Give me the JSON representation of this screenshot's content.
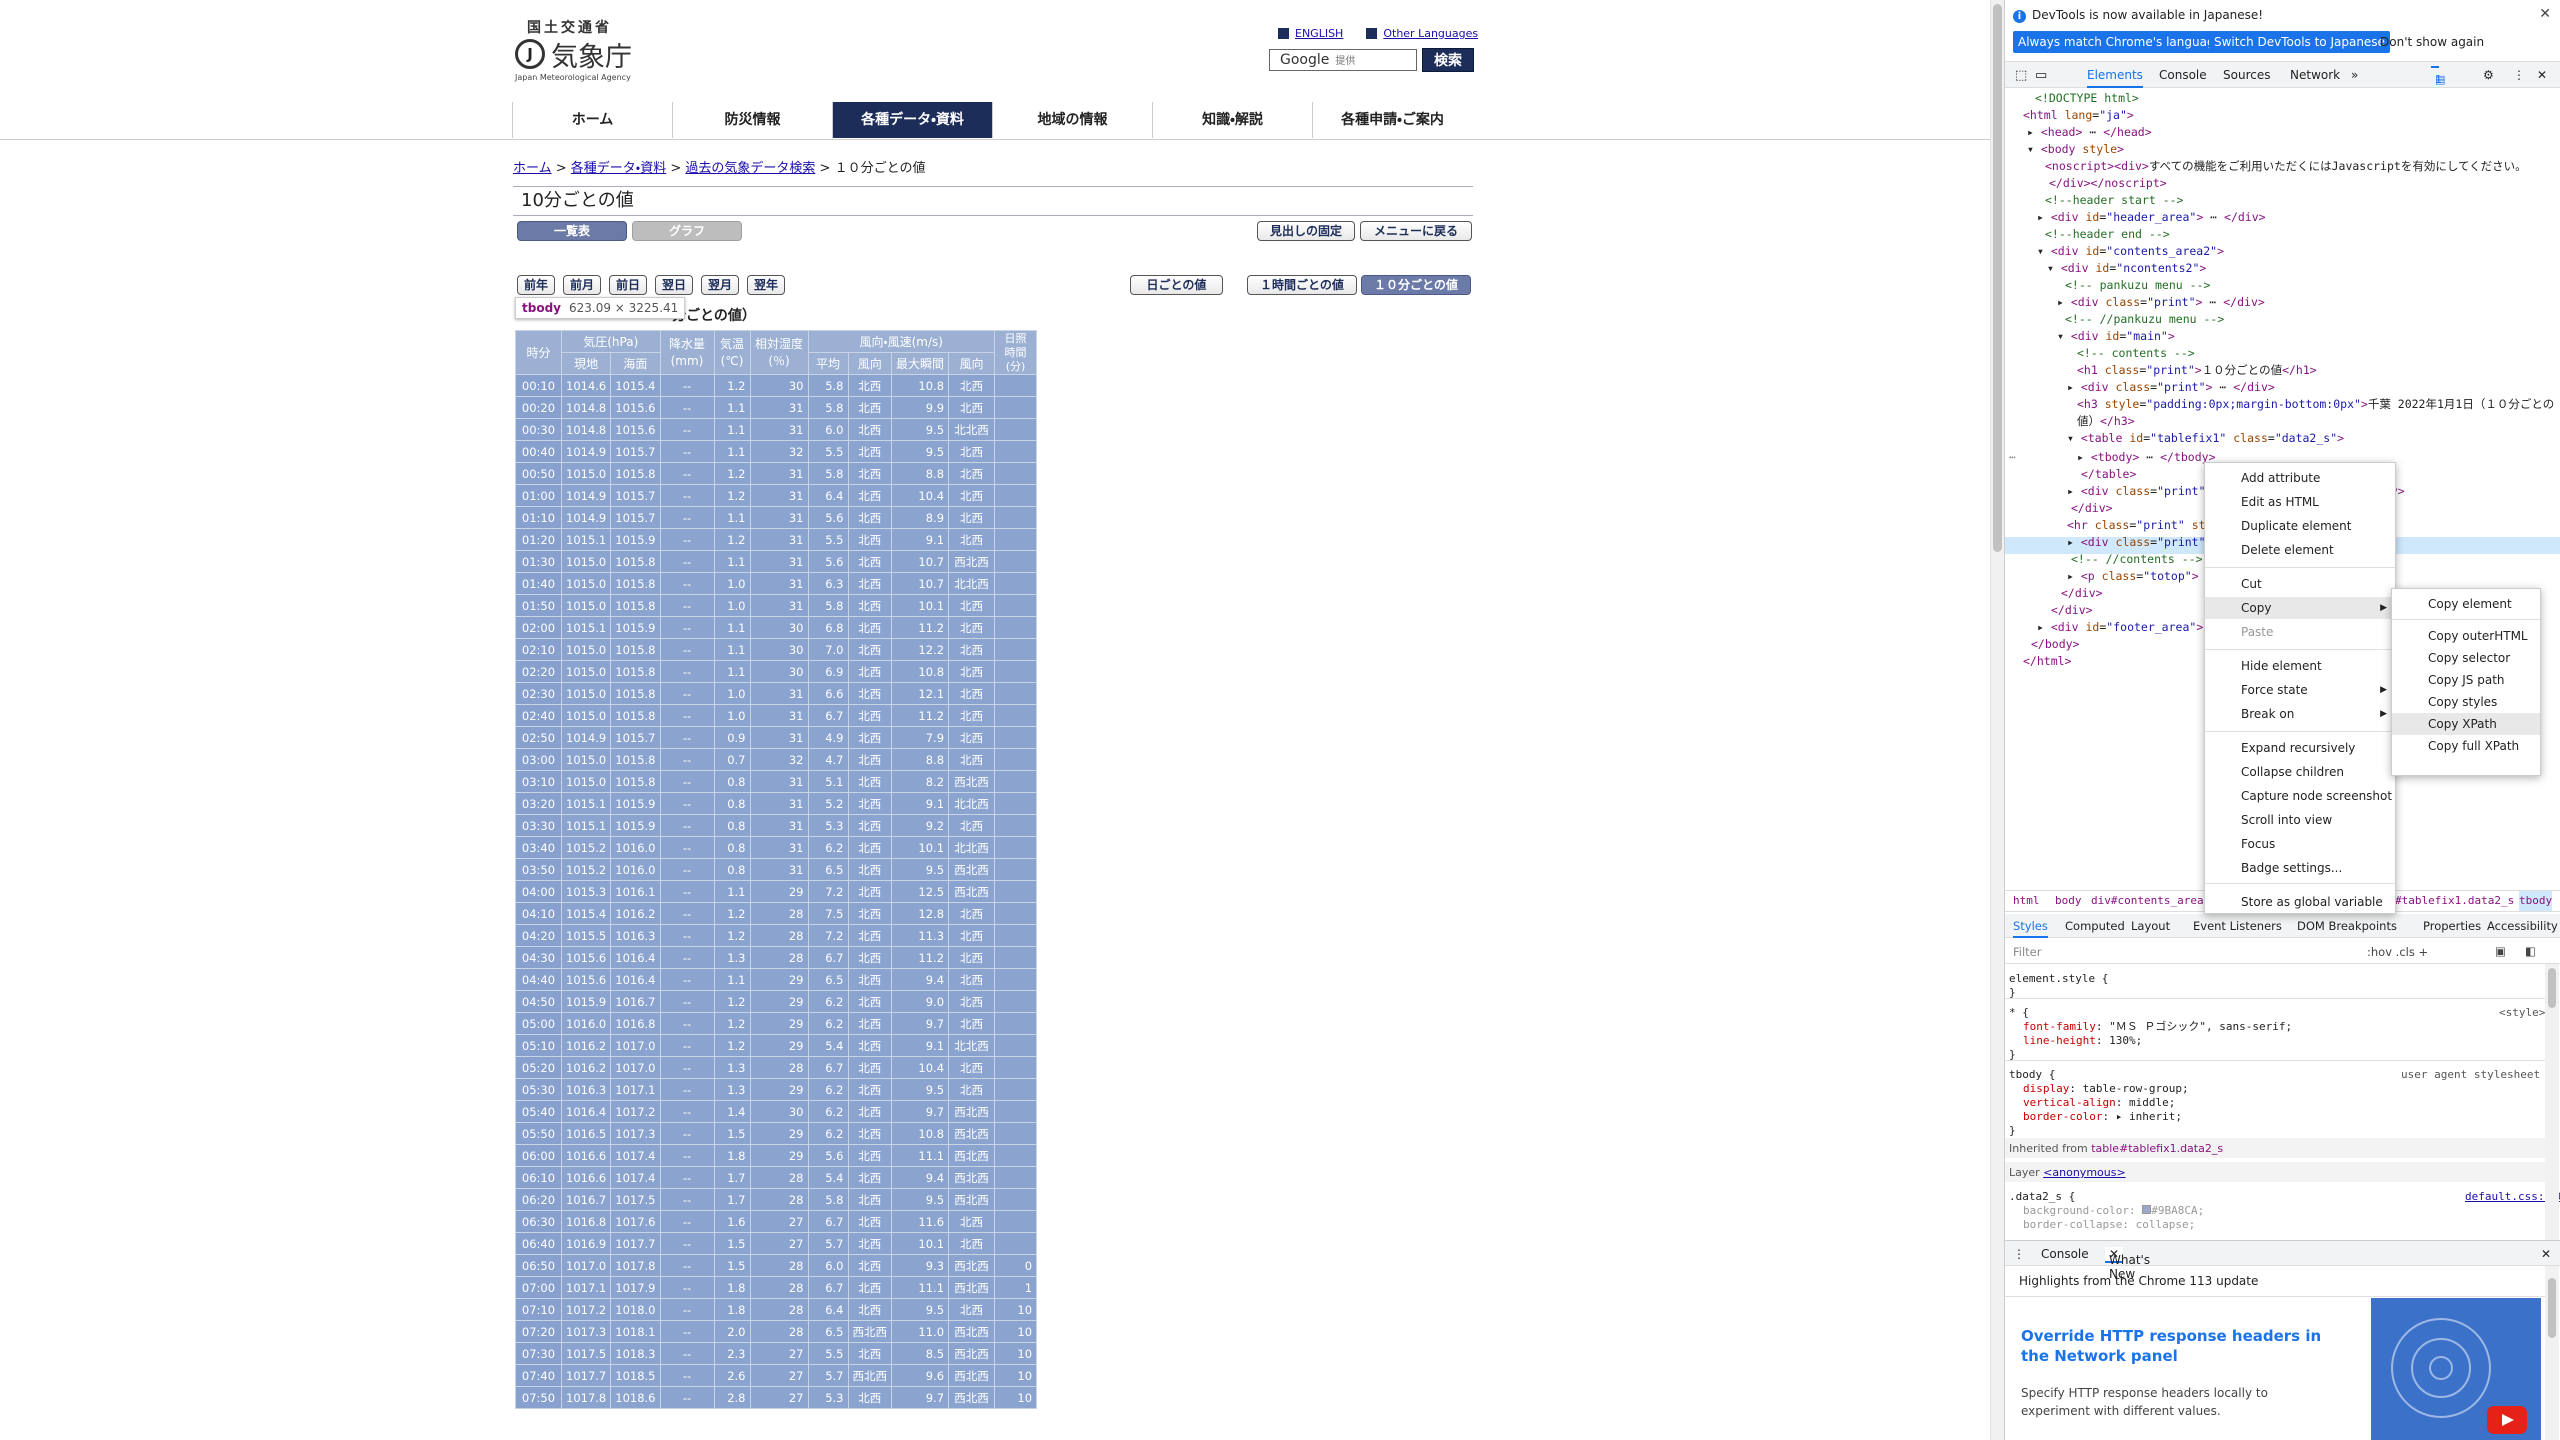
{
  "site": {
    "ministry": "国土交通省",
    "agency": "気象庁",
    "agency_en": "Japan Meteorological Agency",
    "english_link": "ENGLISH",
    "other_lang_link": "Other Languages",
    "search_placeholder_logo": "Google",
    "search_placeholder_text": "提供",
    "search_button": "検索",
    "nav": [
      "ホーム",
      "防災情報",
      "各種データ・資料",
      "地域の情報",
      "知識・解説",
      "各種申請・ご案内"
    ]
  },
  "breadcrumb": {
    "home": "ホーム",
    "data": "各種データ・資料",
    "past": "過去の気象データ検索",
    "current": "１０分ごとの値"
  },
  "page": {
    "title": "10分ごとの値",
    "tab_list": "一覧表",
    "tab_graph": "グラフ",
    "fix_header": "見出しの固定",
    "back_menu": "メニューに戻る",
    "nav_buttons": [
      "前年",
      "前月",
      "前日",
      "翌日",
      "翌月",
      "翌年"
    ],
    "btn_daily": "日ごとの値",
    "btn_hourly": "１時間ごとの値",
    "btn_10min": "１０分ごとの値",
    "subheading": "分ごとの値）",
    "tooltip_tag": "tbody",
    "tooltip_size": "623.09 × 3225.41"
  },
  "table": {
    "h_time": "時分",
    "h_pressure": "気圧(hPa)",
    "h_precip": "降水量 (mm)",
    "h_temp": "気温 (℃)",
    "h_humidity": "相対湿度 (％)",
    "h_wind": "風向・風速(m/s)",
    "h_sun": "日照 時間 (分)",
    "h_local": "現地",
    "h_sea": "海面",
    "h_avg": "平均",
    "h_dir": "風向",
    "h_gust": "最大瞬間",
    "h_gustdir": "風向",
    "rows": [
      [
        "00:10",
        "1014.6",
        "1015.4",
        "--",
        "1.2",
        "30",
        "5.8",
        "北西",
        "10.8",
        "北西",
        ""
      ],
      [
        "00:20",
        "1014.8",
        "1015.6",
        "--",
        "1.1",
        "31",
        "5.8",
        "北西",
        "9.9",
        "北西",
        ""
      ],
      [
        "00:30",
        "1014.8",
        "1015.6",
        "--",
        "1.1",
        "31",
        "6.0",
        "北西",
        "9.5",
        "北北西",
        ""
      ],
      [
        "00:40",
        "1014.9",
        "1015.7",
        "--",
        "1.1",
        "32",
        "5.5",
        "北西",
        "9.5",
        "北西",
        ""
      ],
      [
        "00:50",
        "1015.0",
        "1015.8",
        "--",
        "1.2",
        "31",
        "5.8",
        "北西",
        "8.8",
        "北西",
        ""
      ],
      [
        "01:00",
        "1014.9",
        "1015.7",
        "--",
        "1.2",
        "31",
        "6.4",
        "北西",
        "10.4",
        "北西",
        ""
      ],
      [
        "01:10",
        "1014.9",
        "1015.7",
        "--",
        "1.1",
        "31",
        "5.6",
        "北西",
        "8.9",
        "北西",
        ""
      ],
      [
        "01:20",
        "1015.1",
        "1015.9",
        "--",
        "1.2",
        "31",
        "5.5",
        "北西",
        "9.1",
        "北西",
        ""
      ],
      [
        "01:30",
        "1015.0",
        "1015.8",
        "--",
        "1.1",
        "31",
        "5.6",
        "北西",
        "10.7",
        "西北西",
        ""
      ],
      [
        "01:40",
        "1015.0",
        "1015.8",
        "--",
        "1.0",
        "31",
        "6.3",
        "北西",
        "10.7",
        "北北西",
        ""
      ],
      [
        "01:50",
        "1015.0",
        "1015.8",
        "--",
        "1.0",
        "31",
        "5.8",
        "北西",
        "10.1",
        "北西",
        ""
      ],
      [
        "02:00",
        "1015.1",
        "1015.9",
        "--",
        "1.1",
        "30",
        "6.8",
        "北西",
        "11.2",
        "北西",
        ""
      ],
      [
        "02:10",
        "1015.0",
        "1015.8",
        "--",
        "1.1",
        "30",
        "7.0",
        "北西",
        "12.2",
        "北西",
        ""
      ],
      [
        "02:20",
        "1015.0",
        "1015.8",
        "--",
        "1.1",
        "30",
        "6.9",
        "北西",
        "10.8",
        "北西",
        ""
      ],
      [
        "02:30",
        "1015.0",
        "1015.8",
        "--",
        "1.0",
        "31",
        "6.6",
        "北西",
        "12.1",
        "北西",
        ""
      ],
      [
        "02:40",
        "1015.0",
        "1015.8",
        "--",
        "1.0",
        "31",
        "6.7",
        "北西",
        "11.2",
        "北西",
        ""
      ],
      [
        "02:50",
        "1014.9",
        "1015.7",
        "--",
        "0.9",
        "31",
        "4.9",
        "北西",
        "7.9",
        "北西",
        ""
      ],
      [
        "03:00",
        "1015.0",
        "1015.8",
        "--",
        "0.7",
        "32",
        "4.7",
        "北西",
        "8.8",
        "北西",
        ""
      ],
      [
        "03:10",
        "1015.0",
        "1015.8",
        "--",
        "0.8",
        "31",
        "5.1",
        "北西",
        "8.2",
        "西北西",
        ""
      ],
      [
        "03:20",
        "1015.1",
        "1015.9",
        "--",
        "0.8",
        "31",
        "5.2",
        "北西",
        "9.1",
        "北北西",
        ""
      ],
      [
        "03:30",
        "1015.1",
        "1015.9",
        "--",
        "0.8",
        "31",
        "5.3",
        "北西",
        "9.2",
        "北西",
        ""
      ],
      [
        "03:40",
        "1015.2",
        "1016.0",
        "--",
        "0.8",
        "31",
        "6.2",
        "北西",
        "10.1",
        "北北西",
        ""
      ],
      [
        "03:50",
        "1015.2",
        "1016.0",
        "--",
        "0.8",
        "31",
        "6.5",
        "北西",
        "9.5",
        "西北西",
        ""
      ],
      [
        "04:00",
        "1015.3",
        "1016.1",
        "--",
        "1.1",
        "29",
        "7.2",
        "北西",
        "12.5",
        "西北西",
        ""
      ],
      [
        "04:10",
        "1015.4",
        "1016.2",
        "--",
        "1.2",
        "28",
        "7.5",
        "北西",
        "12.8",
        "北西",
        ""
      ],
      [
        "04:20",
        "1015.5",
        "1016.3",
        "--",
        "1.2",
        "28",
        "7.2",
        "北西",
        "11.3",
        "北西",
        ""
      ],
      [
        "04:30",
        "1015.6",
        "1016.4",
        "--",
        "1.3",
        "28",
        "6.7",
        "北西",
        "11.2",
        "北西",
        ""
      ],
      [
        "04:40",
        "1015.6",
        "1016.4",
        "--",
        "1.1",
        "29",
        "6.5",
        "北西",
        "9.4",
        "北西",
        ""
      ],
      [
        "04:50",
        "1015.9",
        "1016.7",
        "--",
        "1.2",
        "29",
        "6.2",
        "北西",
        "9.0",
        "北西",
        ""
      ],
      [
        "05:00",
        "1016.0",
        "1016.8",
        "--",
        "1.2",
        "29",
        "6.2",
        "北西",
        "9.7",
        "北西",
        ""
      ],
      [
        "05:10",
        "1016.2",
        "1017.0",
        "--",
        "1.2",
        "29",
        "5.4",
        "北西",
        "9.1",
        "北北西",
        ""
      ],
      [
        "05:20",
        "1016.2",
        "1017.0",
        "--",
        "1.3",
        "28",
        "6.7",
        "北西",
        "10.4",
        "北西",
        ""
      ],
      [
        "05:30",
        "1016.3",
        "1017.1",
        "--",
        "1.3",
        "29",
        "6.2",
        "北西",
        "9.5",
        "北西",
        ""
      ],
      [
        "05:40",
        "1016.4",
        "1017.2",
        "--",
        "1.4",
        "30",
        "6.2",
        "北西",
        "9.7",
        "西北西",
        ""
      ],
      [
        "05:50",
        "1016.5",
        "1017.3",
        "--",
        "1.5",
        "29",
        "6.2",
        "北西",
        "10.8",
        "西北西",
        ""
      ],
      [
        "06:00",
        "1016.6",
        "1017.4",
        "--",
        "1.8",
        "29",
        "5.6",
        "北西",
        "11.1",
        "西北西",
        ""
      ],
      [
        "06:10",
        "1016.6",
        "1017.4",
        "--",
        "1.7",
        "28",
        "5.4",
        "北西",
        "9.4",
        "西北西",
        ""
      ],
      [
        "06:20",
        "1016.7",
        "1017.5",
        "--",
        "1.7",
        "28",
        "5.8",
        "北西",
        "9.5",
        "西北西",
        ""
      ],
      [
        "06:30",
        "1016.8",
        "1017.6",
        "--",
        "1.6",
        "27",
        "6.7",
        "北西",
        "11.6",
        "北西",
        ""
      ],
      [
        "06:40",
        "1016.9",
        "1017.7",
        "--",
        "1.5",
        "27",
        "5.7",
        "北西",
        "10.1",
        "北西",
        ""
      ],
      [
        "06:50",
        "1017.0",
        "1017.8",
        "--",
        "1.5",
        "28",
        "6.0",
        "北西",
        "9.3",
        "西北西",
        "0"
      ],
      [
        "07:00",
        "1017.1",
        "1017.9",
        "--",
        "1.8",
        "28",
        "6.7",
        "北西",
        "11.1",
        "西北西",
        "1"
      ],
      [
        "07:10",
        "1017.2",
        "1018.0",
        "--",
        "1.8",
        "28",
        "6.4",
        "北西",
        "9.5",
        "北西",
        "10"
      ],
      [
        "07:20",
        "1017.3",
        "1018.1",
        "--",
        "2.0",
        "28",
        "6.5",
        "西北西",
        "11.0",
        "西北西",
        "10"
      ],
      [
        "07:30",
        "1017.5",
        "1018.3",
        "--",
        "2.3",
        "27",
        "5.5",
        "北西",
        "8.5",
        "西北西",
        "10"
      ],
      [
        "07:40",
        "1017.7",
        "1018.5",
        "--",
        "2.6",
        "27",
        "5.7",
        "西北西",
        "9.6",
        "西北西",
        "10"
      ],
      [
        "07:50",
        "1017.8",
        "1018.6",
        "--",
        "2.8",
        "27",
        "5.3",
        "北西",
        "9.7",
        "西北西",
        "10"
      ]
    ]
  },
  "devtools": {
    "banner": "DevTools is now available in Japanese!",
    "btn_match": "Always match Chrome's language",
    "btn_switch": "Switch DevTools to Japanese",
    "btn_dont": "Don't show again",
    "tabs": [
      "Elements",
      "Console",
      "Sources",
      "Network"
    ],
    "issues_count": "1",
    "context_menu": [
      "Add attribute",
      "Edit as HTML",
      "Duplicate element",
      "Delete element",
      "Cut",
      "Copy",
      "Paste",
      "Hide element",
      "Force state",
      "Break on",
      "Expand recursively",
      "Collapse children",
      "Capture node screenshot",
      "Scroll into view",
      "Focus",
      "Badge settings...",
      "Store as global variable"
    ],
    "copy_submenu": [
      "Copy element",
      "Copy outerHTML",
      "Copy selector",
      "Copy JS path",
      "Copy styles",
      "Copy XPath",
      "Copy full XPath"
    ],
    "crumbs": [
      "html",
      "body",
      "div#contents_area2",
      "#tablefix1.data2_s",
      "tbody"
    ],
    "style_tabs": [
      "Styles",
      "Computed",
      "Layout",
      "Event Listeners",
      "DOM Breakpoints",
      "Properties",
      "Accessibility"
    ],
    "filter": "Filter",
    "filter_tools": ":hov  .cls  +",
    "drawer_tabs": [
      "Console",
      "What's New"
    ],
    "whatsnew_highlight": "Highlights from the Chrome 113 update",
    "whatsnew_title": "Override HTTP response headers in the Network panel",
    "whatsnew_body": "Specify HTTP response headers locally to experiment with different values."
  }
}
